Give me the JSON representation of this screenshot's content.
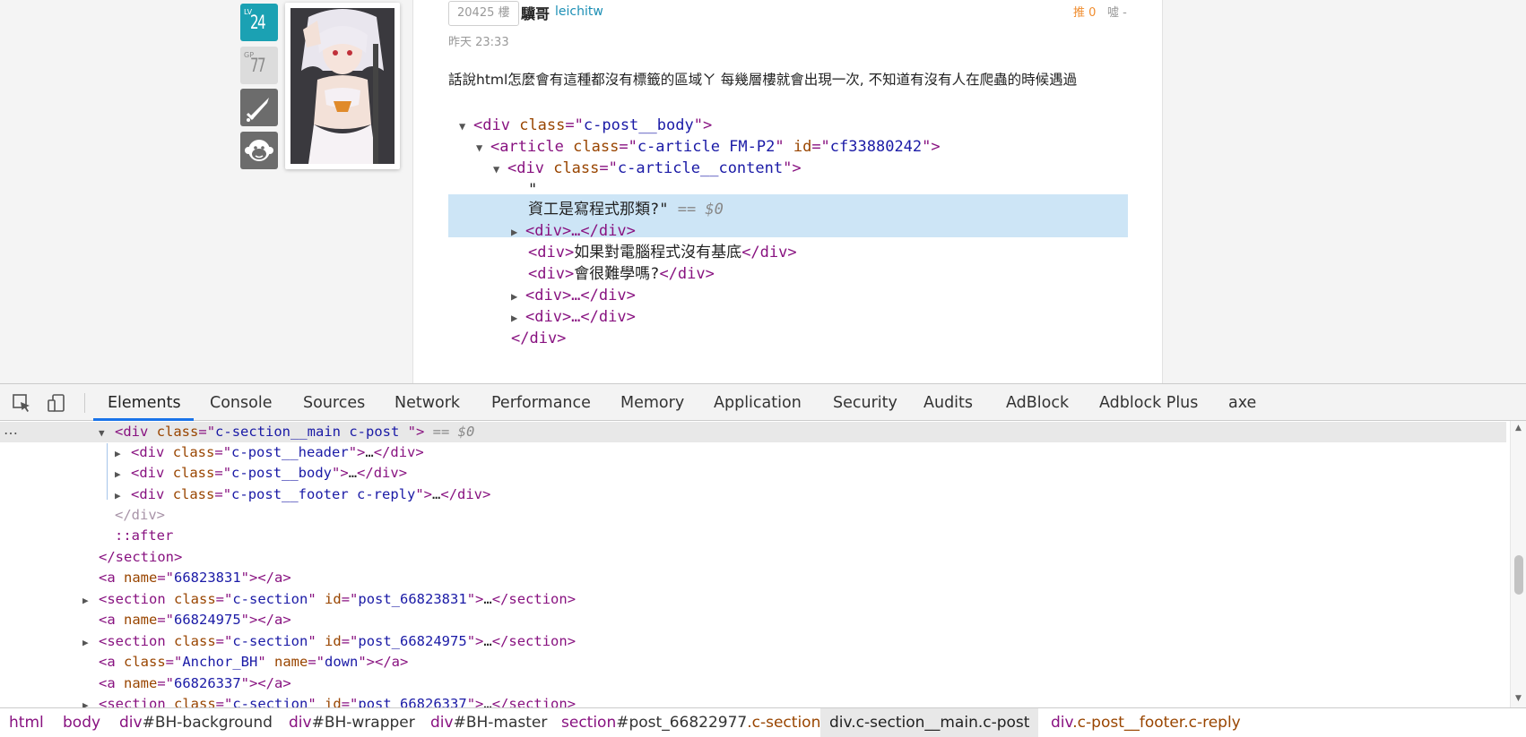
{
  "user": {
    "level_prefix": "LV",
    "level": "24",
    "gp_prefix": "GP",
    "gp": "77"
  },
  "post": {
    "floor": "20425 樓",
    "author": "驥哥",
    "author_id": "leichitw",
    "time": "昨天 23:33",
    "vote_up": "推 0",
    "vote_down": "噓 -",
    "text": "話說html怎麼會有這種都沒有標籤的區域ㄚ 每幾層樓就會出現一次, 不知道有沒有人在爬蟲的時候遇過"
  },
  "embed": {
    "lines": [
      {
        "open": "<",
        "tag": "div",
        "attr": " class",
        "eq": "=\"",
        "val": "c-post__body",
        "close": "\">"
      },
      {
        "open": "<",
        "tag": "article",
        "attr": " class",
        "eq": "=\"",
        "val": "c-article FM-P2",
        "mid": "\" ",
        "attr2": "id",
        "eq2": "=\"",
        "val2": "cf33880242",
        "close": "\">"
      },
      {
        "open": "<",
        "tag": "div",
        "attr": " class",
        "eq": "=\"",
        "val": "c-article__content",
        "close": "\">"
      }
    ],
    "quote": "\"",
    "text_node": "資工是寫程式那類?\"",
    "dollar": " == $0",
    "div_collapsed": "<div>…</div>",
    "line_a": "如果對電腦程式沒有基底",
    "line_b": "會很難學嗎?",
    "div_open": "<div>",
    "div_close": "</div>",
    "close_div": "</div>"
  },
  "devtools": {
    "tabs": [
      "Elements",
      "Console",
      "Sources",
      "Network",
      "Performance",
      "Memory",
      "Application",
      "Security",
      "Audits",
      "AdBlock",
      "Adblock Plus",
      "axe"
    ],
    "active_tab": "Elements"
  },
  "dom": {
    "selected": {
      "tag": "div",
      "attr": "class",
      "val": "c-section__main c-post ",
      "suffix": " == $0"
    },
    "children": [
      {
        "tag": "div",
        "attr": "class",
        "val": "c-post__header"
      },
      {
        "tag": "div",
        "attr": "class",
        "val": "c-post__body"
      },
      {
        "tag": "div",
        "attr": "class",
        "val": "c-post__footer c-reply"
      }
    ],
    "close_div": "</div>",
    "after": "::after",
    "close_section": "</section>",
    "anchors": [
      {
        "name": "66823831"
      },
      {
        "section_id": "post_66823831"
      },
      {
        "name": "66824975"
      },
      {
        "section_id": "post_66824975"
      },
      {
        "class": "Anchor_BH",
        "name": "down"
      },
      {
        "name": "66826337"
      },
      {
        "section_id": "post_66826337"
      }
    ],
    "section_class": "c-section",
    "ellipsis": "…"
  },
  "breadcrumbs": [
    {
      "tag": "html"
    },
    {
      "tag": "body"
    },
    {
      "tag": "div",
      "id": "#BH-background"
    },
    {
      "tag": "div",
      "id": "#BH-wrapper"
    },
    {
      "tag": "div",
      "id": "#BH-master"
    },
    {
      "tag": "section",
      "id": "#post_66822977",
      "cls": ".c-section"
    },
    {
      "tag": "div",
      "cls": ".c-section__main.c-post",
      "current": true
    },
    {
      "tag": "div",
      "cls": ".c-post__footer.c-reply"
    }
  ]
}
